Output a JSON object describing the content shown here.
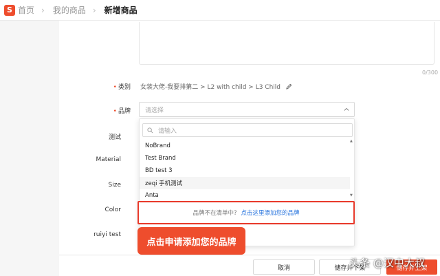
{
  "header": {
    "logo_letter": "S",
    "breadcrumb": [
      "首页",
      "我的商品",
      "新增商品"
    ]
  },
  "form": {
    "description_counter": "0/300",
    "category": {
      "label": "类别",
      "value": "女装大佬-我要排第二 > L2 with child > L3 Child"
    },
    "brand": {
      "label": "品牌",
      "placeholder": "请选择",
      "search_placeholder": "请输入",
      "options": [
        "NoBrand",
        "Test Brand",
        "BD test 3",
        "zeqi 手机测试",
        "Anta"
      ],
      "hovered_index": 3,
      "not_in_list_text": "品牌不在清单中?",
      "add_brand_link": "点击这里添加您的品牌"
    },
    "attributes": [
      "测试",
      "Material",
      "Size",
      "Color",
      "ruiyi test"
    ]
  },
  "callout": "点击申请添加您的品牌",
  "footer": {
    "cancel": "取消",
    "save_hide": "储存并下架",
    "save_publish": "储存并上架"
  },
  "watermark": "头条 @汉中大叔",
  "colors": {
    "accent": "#ee4d2d",
    "link": "#2673dd",
    "highlight_border": "#e8392a"
  }
}
